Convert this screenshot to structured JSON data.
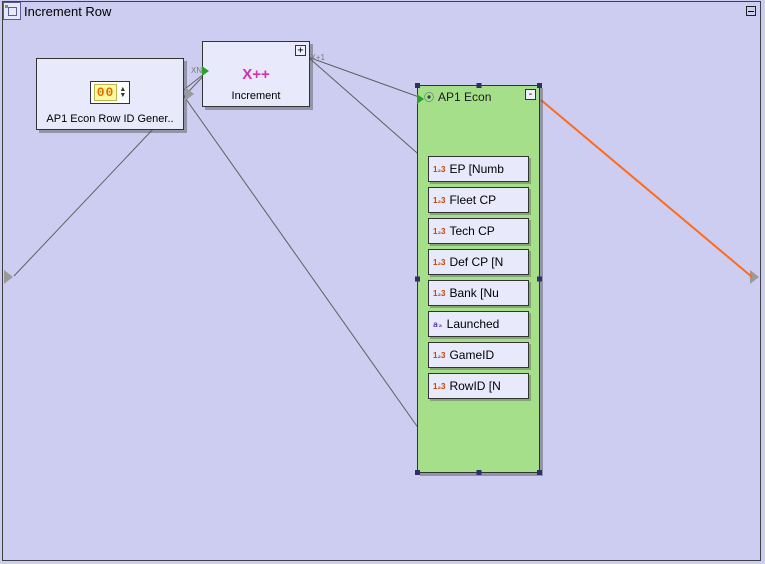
{
  "title": "Increment Row",
  "collapse_glyph": "+",
  "minimize_glyph": "-",
  "generator_node": {
    "caption": "AP1 Econ Row ID Gener..",
    "digits": "00"
  },
  "increment_node": {
    "symbol": "X++",
    "caption": "Increment",
    "port_in_label": "XN",
    "port_out_label": "X+1"
  },
  "cluster": {
    "title": "AP1 Econ",
    "fields": [
      {
        "type": "num",
        "label": "EP [Numb"
      },
      {
        "type": "num",
        "label": "Fleet CP "
      },
      {
        "type": "num",
        "label": "Tech CP "
      },
      {
        "type": "num",
        "label": "Def CP [N"
      },
      {
        "type": "num",
        "label": "Bank [Nu"
      },
      {
        "type": "str",
        "label": "Launched"
      },
      {
        "type": "num",
        "label": "GameID "
      },
      {
        "type": "num",
        "label": "RowID [N"
      }
    ]
  },
  "field_icons": {
    "num": "1₂3",
    "str": "aₐ"
  }
}
